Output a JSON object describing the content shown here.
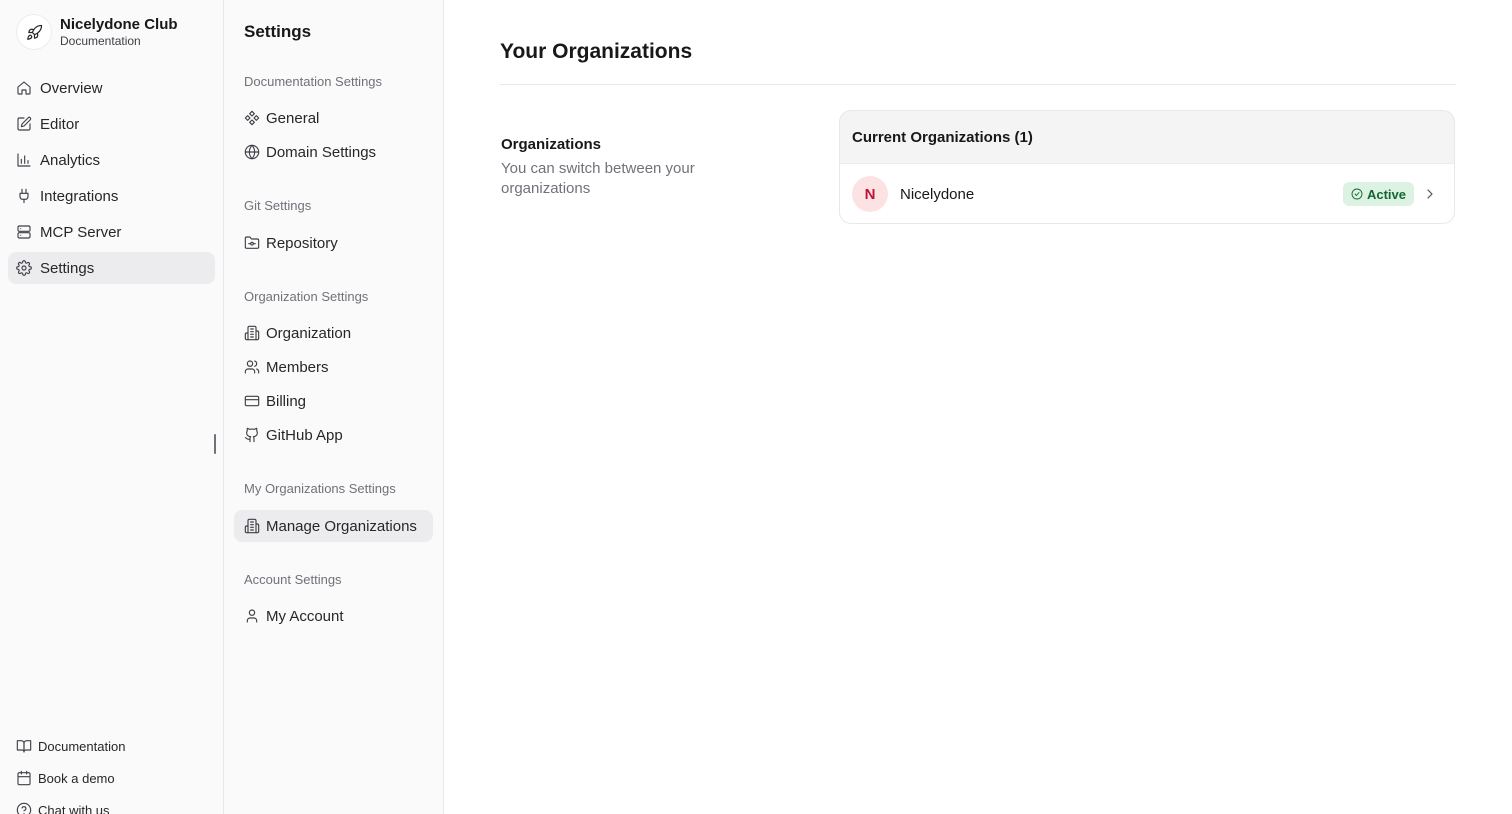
{
  "brand": {
    "name": "Nicelydone Club",
    "subtitle": "Documentation",
    "icon": "rocket-icon"
  },
  "nav": {
    "items": [
      {
        "label": "Overview",
        "icon": "home-icon"
      },
      {
        "label": "Editor",
        "icon": "edit-icon"
      },
      {
        "label": "Analytics",
        "icon": "bar-chart-icon"
      },
      {
        "label": "Integrations",
        "icon": "plug-icon"
      },
      {
        "label": "MCP Server",
        "icon": "server-icon"
      },
      {
        "label": "Settings",
        "icon": "gear-icon",
        "active": true
      }
    ]
  },
  "bottom_links": [
    {
      "label": "Documentation",
      "icon": "book-icon"
    },
    {
      "label": "Book a demo",
      "icon": "calendar-icon"
    },
    {
      "label": "Chat with us",
      "icon": "help-circle-icon"
    }
  ],
  "settings": {
    "title": "Settings",
    "sections": [
      {
        "label": "Documentation Settings",
        "items": [
          {
            "label": "General"
          },
          {
            "label": "Domain Settings"
          }
        ]
      },
      {
        "label": "Git Settings",
        "items": [
          {
            "label": "Repository"
          }
        ]
      },
      {
        "label": "Organization Settings",
        "items": [
          {
            "label": "Organization"
          },
          {
            "label": "Members"
          },
          {
            "label": "Billing"
          },
          {
            "label": "GitHub App"
          }
        ]
      },
      {
        "label": "My Organizations Settings",
        "items": [
          {
            "label": "Manage Organizations",
            "active": true
          }
        ]
      },
      {
        "label": "Account Settings",
        "items": [
          {
            "label": "My Account"
          }
        ]
      }
    ]
  },
  "main": {
    "title": "Your Organizations",
    "section_label": "Organizations",
    "section_description": "You can switch between your organizations",
    "card_header": "Current Organizations (1)",
    "organizations": [
      {
        "initial": "N",
        "name": "Nicelydone",
        "status": "Active"
      }
    ]
  },
  "colors": {
    "active_bg": "#ececee",
    "badge_bg": "#dcf3e3",
    "badge_text": "#166534",
    "avatar_bg": "#fde2e4",
    "avatar_text": "#be123c"
  }
}
